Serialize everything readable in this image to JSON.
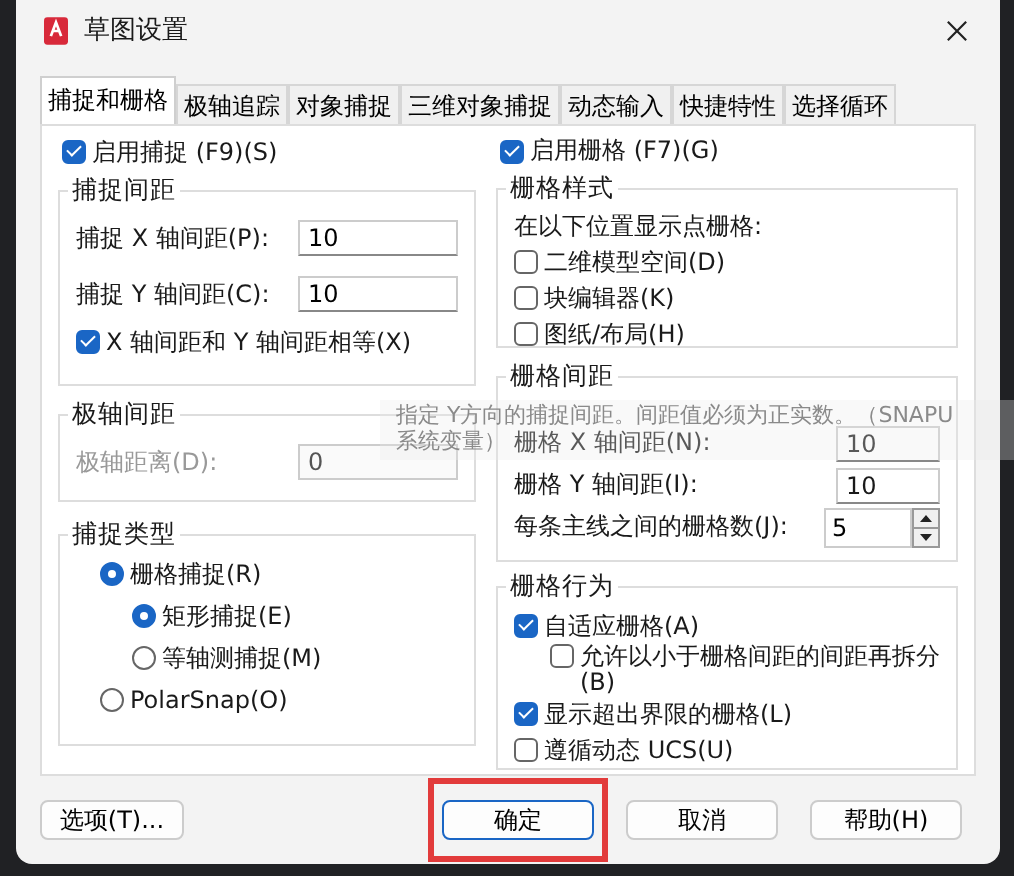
{
  "window": {
    "title": "草图设置"
  },
  "tabs": [
    {
      "label": "捕捉和栅格",
      "selected": true
    },
    {
      "label": "极轴追踪",
      "selected": false
    },
    {
      "label": "对象捕捉",
      "selected": false
    },
    {
      "label": "三维对象捕捉",
      "selected": false
    },
    {
      "label": "动态输入",
      "selected": false
    },
    {
      "label": "快捷特性",
      "selected": false
    },
    {
      "label": "选择循环",
      "selected": false
    }
  ],
  "snap": {
    "enable": {
      "label": "启用捕捉 (F9)(S)",
      "checked": true
    },
    "spacing": {
      "title": "捕捉间距",
      "fields": [
        {
          "label": "捕捉 X 轴间距(P):",
          "value": "10"
        },
        {
          "label": "捕捉 Y 轴间距(C):",
          "value": "10"
        }
      ],
      "equal": {
        "label": "X 轴间距和 Y 轴间距相等(X)",
        "checked": true
      }
    },
    "polar": {
      "title": "极轴间距",
      "label": "极轴距离(D):",
      "value": "0",
      "disabled": true
    },
    "type": {
      "title": "捕捉类型",
      "options": [
        {
          "label": "栅格捕捉(R)",
          "selected": true,
          "children": [
            {
              "label": "矩形捕捉(E)",
              "selected": true
            },
            {
              "label": "等轴测捕捉(M)",
              "selected": false
            }
          ]
        },
        {
          "label": "PolarSnap(O)",
          "selected": false
        }
      ]
    }
  },
  "grid": {
    "enable": {
      "label": "启用栅格 (F7)(G)",
      "checked": true
    },
    "style": {
      "title": "栅格样式",
      "caption": "在以下位置显示点栅格:",
      "options": [
        {
          "label": "二维模型空间(D)",
          "checked": false
        },
        {
          "label": "块编辑器(K)",
          "checked": false
        },
        {
          "label": "图纸/布局(H)",
          "checked": false
        }
      ]
    },
    "spacing": {
      "title": "栅格间距",
      "fields": [
        {
          "label": "栅格 X 轴间距(N):",
          "value": "10"
        },
        {
          "label": "栅格 Y 轴间距(I):",
          "value": "10"
        }
      ],
      "major": {
        "label": "每条主线之间的栅格数(J):",
        "value": "5"
      }
    },
    "behavior": {
      "title": "栅格行为",
      "options": [
        {
          "label": "自适应栅格(A)",
          "checked": true,
          "children": [
            {
              "label": "允许以小于栅格间距的间距再拆分(B)",
              "checked": false
            }
          ]
        },
        {
          "label": "显示超出界限的栅格(L)",
          "checked": true
        },
        {
          "label": "遵循动态 UCS(U)",
          "checked": false
        }
      ]
    }
  },
  "tooltip": {
    "lines": [
      "指定 Y方向的捕捉间距。间距值必须为正实数。（SNAPU",
      "系统变量）"
    ]
  },
  "options_button": "选项(T)...",
  "buttons": [
    {
      "label": "确定",
      "highlighted": true
    },
    {
      "label": "取消",
      "highlighted": false
    },
    {
      "label": "帮助(H)",
      "highlighted": false
    }
  ]
}
